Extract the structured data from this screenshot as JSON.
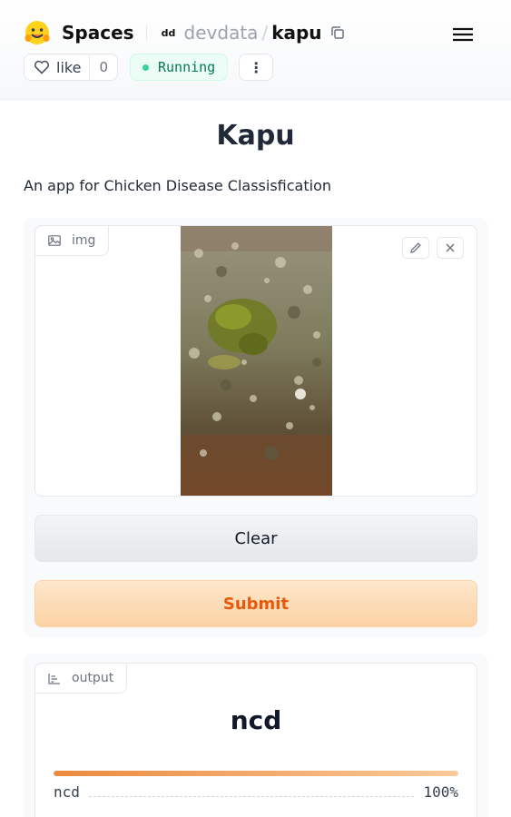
{
  "header": {
    "brand_label": "Spaces",
    "owner": "devdata",
    "separator": "/",
    "repo": "kapu",
    "org_avatar_text": "dd",
    "like_label": "like",
    "like_count": "0",
    "status_label": "Running",
    "more_label": "⋮"
  },
  "app": {
    "title": "Kapu",
    "description": "An app for Chicken Disease Classisfication"
  },
  "input": {
    "image_label": "img",
    "clear_label": "Clear",
    "submit_label": "Submit"
  },
  "output": {
    "label": "output",
    "predicted_class": "ncd",
    "confidences": [
      {
        "label": "ncd",
        "percent_text": "100%",
        "fraction": 1.0
      }
    ]
  },
  "colors": {
    "accent_orange": "#ea580c",
    "status_green": "#047857",
    "status_dot": "#34d399"
  }
}
